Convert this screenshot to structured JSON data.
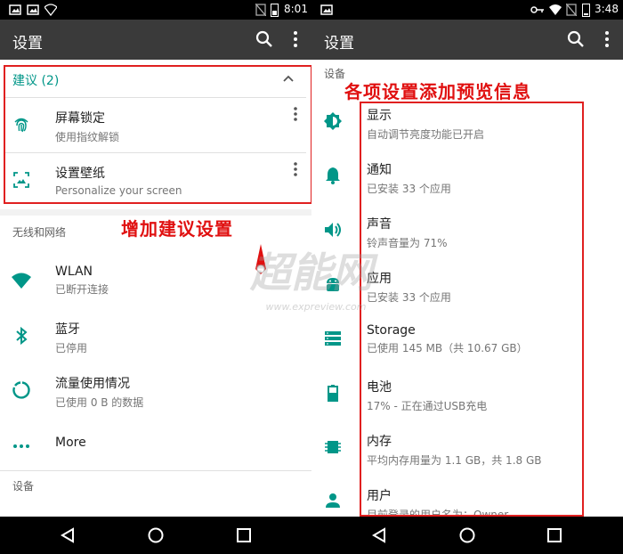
{
  "left": {
    "statusbar": {
      "time": "8:01"
    },
    "toolbar": {
      "title": "设置"
    },
    "suggestions": {
      "header": "建议 (2)",
      "items": [
        {
          "title": "屏幕锁定",
          "subtitle": "使用指纹解锁",
          "icon": "fingerprint-icon"
        },
        {
          "title": "设置壁纸",
          "subtitle": "Personalize your screen",
          "icon": "wallpaper-icon"
        }
      ]
    },
    "annotation": "增加建议设置",
    "network_section": "无线和网络",
    "network_items": [
      {
        "title": "WLAN",
        "subtitle": "已断开连接",
        "icon": "wifi-icon"
      },
      {
        "title": "蓝牙",
        "subtitle": "已停用",
        "icon": "bluetooth-icon"
      },
      {
        "title": "流量使用情况",
        "subtitle": "已使用 0 B 的数据",
        "icon": "data-usage-icon"
      },
      {
        "title": "More",
        "subtitle": "",
        "icon": "more-horiz-icon"
      }
    ],
    "device_section": "设备"
  },
  "right": {
    "statusbar": {
      "time": "3:48"
    },
    "toolbar": {
      "title": "设置"
    },
    "device_section": "设备",
    "annotation": "各项设置添加预览信息",
    "items": [
      {
        "title": "显示",
        "subtitle": "自动调节亮度功能已开启",
        "icon": "brightness-icon"
      },
      {
        "title": "通知",
        "subtitle": "已安装 33 个应用",
        "icon": "bell-icon"
      },
      {
        "title": "声音",
        "subtitle": "铃声音量为 71%",
        "icon": "volume-icon"
      },
      {
        "title": "应用",
        "subtitle": "已安装 33 个应用",
        "icon": "android-icon"
      },
      {
        "title": "Storage",
        "subtitle": "已使用 145 MB（共 10.67 GB）",
        "icon": "storage-icon"
      },
      {
        "title": "电池",
        "subtitle": "17% - 正在通过USB充电",
        "icon": "battery-icon"
      },
      {
        "title": "内存",
        "subtitle": "平均内存用量为 1.1 GB，共 1.8 GB",
        "icon": "memory-icon"
      },
      {
        "title": "用户",
        "subtitle": "目前登录的用户名为：Owner",
        "icon": "person-icon"
      }
    ]
  },
  "watermark": {
    "main": "超能网",
    "sub": "www.expreview.com"
  },
  "colors": {
    "accent": "#009688",
    "annotation": "#e01010",
    "toolbar": "#3a3a3a"
  }
}
